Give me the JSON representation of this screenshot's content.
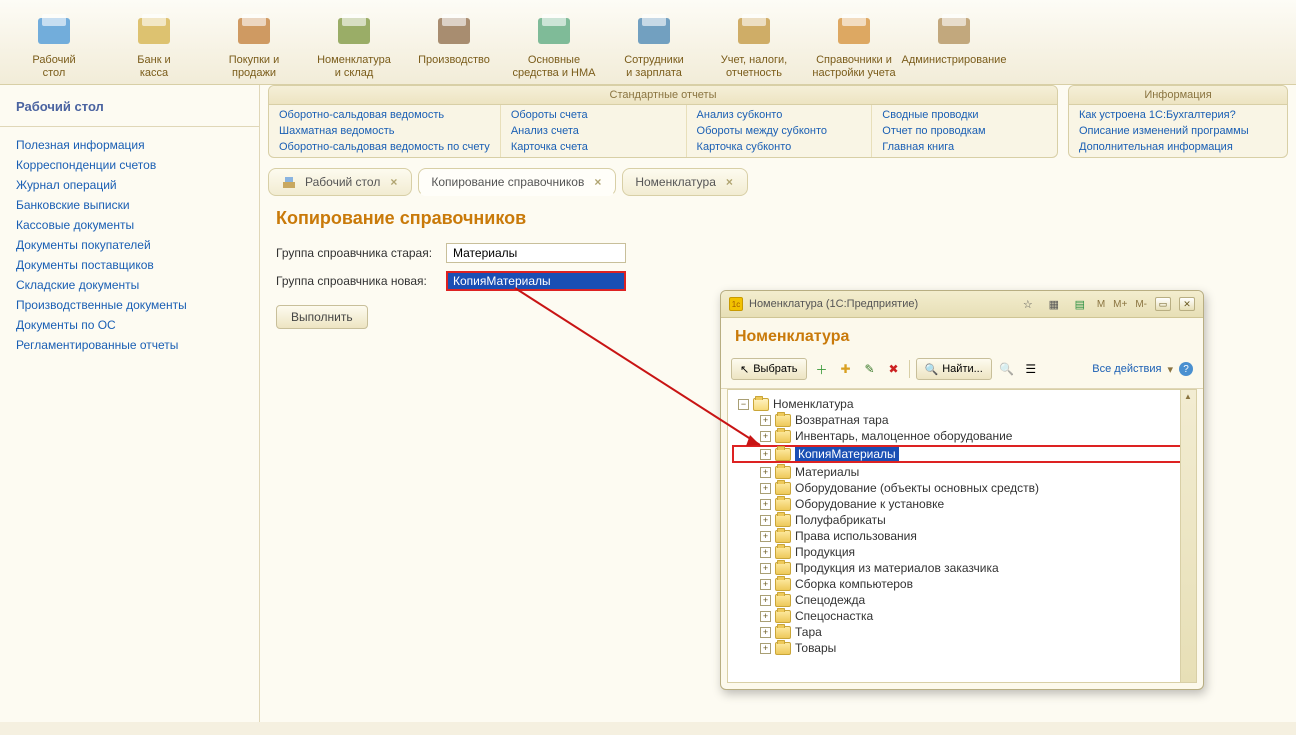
{
  "ribbon": [
    {
      "label": "Рабочий\nстол",
      "name": "desktop"
    },
    {
      "label": "Банк и\nкасса",
      "name": "bank-cash"
    },
    {
      "label": "Покупки и\nпродажи",
      "name": "sales"
    },
    {
      "label": "Номенклатура\nи склад",
      "name": "nomenclature"
    },
    {
      "label": "Производство",
      "name": "production"
    },
    {
      "label": "Основные\nсредства и НМА",
      "name": "fixed-assets"
    },
    {
      "label": "Сотрудники\nи зарплата",
      "name": "employees"
    },
    {
      "label": "Учет, налоги,\nотчетность",
      "name": "tax"
    },
    {
      "label": "Справочники и\nнастройки учета",
      "name": "reference"
    },
    {
      "label": "Администрирование",
      "name": "admin"
    }
  ],
  "sidebar": {
    "title": "Рабочий стол",
    "links": [
      "Полезная информация",
      "Корреспонденции счетов",
      "Журнал операций",
      "Банковские выписки",
      "Кассовые документы",
      "Документы покупателей",
      "Документы поставщиков",
      "Складские документы",
      "Производственные документы",
      "Документы по ОС",
      "Регламентированные отчеты"
    ]
  },
  "reports": {
    "standard_title": "Стандартные отчеты",
    "info_title": "Информация",
    "cols": [
      [
        "Оборотно-сальдовая ведомость",
        "Шахматная ведомость",
        "Оборотно-сальдовая ведомость по счету"
      ],
      [
        "Обороты счета",
        "Анализ счета",
        "Карточка счета"
      ],
      [
        "Анализ субконто",
        "Обороты между субконто",
        "Карточка субконто"
      ],
      [
        "Сводные проводки",
        "Отчет по проводкам",
        "Главная книга"
      ]
    ],
    "info": [
      "Как устроена 1С:Бухгалтерия?",
      "Описание изменений программы",
      "Дополнительная информация"
    ]
  },
  "tabs": [
    {
      "label": "Рабочий стол",
      "icon": "desk"
    },
    {
      "label": "Копирование справочников",
      "icon": "",
      "active": true
    },
    {
      "label": "Номенклатура",
      "icon": ""
    }
  ],
  "page": {
    "title": "Копирование справочников",
    "label_old": "Группа спроавчника старая:",
    "value_old": "Материалы",
    "label_new": "Группа спроавчника новая:",
    "value_new": "КопияМатериалы",
    "execute": "Выполнить"
  },
  "dialog": {
    "titlebar": "Номенклатура  (1С:Предприятие)",
    "title": "Номенклатура",
    "choose": "Выбрать",
    "find": "Найти...",
    "all_actions": "Все действия",
    "mem": [
      "M",
      "M+",
      "M-"
    ],
    "tree": [
      {
        "label": "Номенклатура",
        "level": 1,
        "open": true
      },
      {
        "label": "Возвратная тара",
        "level": 2
      },
      {
        "label": "Инвентарь, малоценное оборудование",
        "level": 2
      },
      {
        "label": "КопияМатериалы",
        "level": 2,
        "selected": true
      },
      {
        "label": "Материалы",
        "level": 2
      },
      {
        "label": "Оборудование (объекты основных средств)",
        "level": 2
      },
      {
        "label": "Оборудование к установке",
        "level": 2
      },
      {
        "label": "Полуфабрикаты",
        "level": 2
      },
      {
        "label": "Права использования",
        "level": 2
      },
      {
        "label": "Продукция",
        "level": 2
      },
      {
        "label": "Продукция из материалов заказчика",
        "level": 2
      },
      {
        "label": "Сборка компьютеров",
        "level": 2
      },
      {
        "label": "Спецодежда",
        "level": 2
      },
      {
        "label": "Спецоснастка",
        "level": 2
      },
      {
        "label": "Тара",
        "level": 2
      },
      {
        "label": "Товары",
        "level": 2
      }
    ]
  }
}
